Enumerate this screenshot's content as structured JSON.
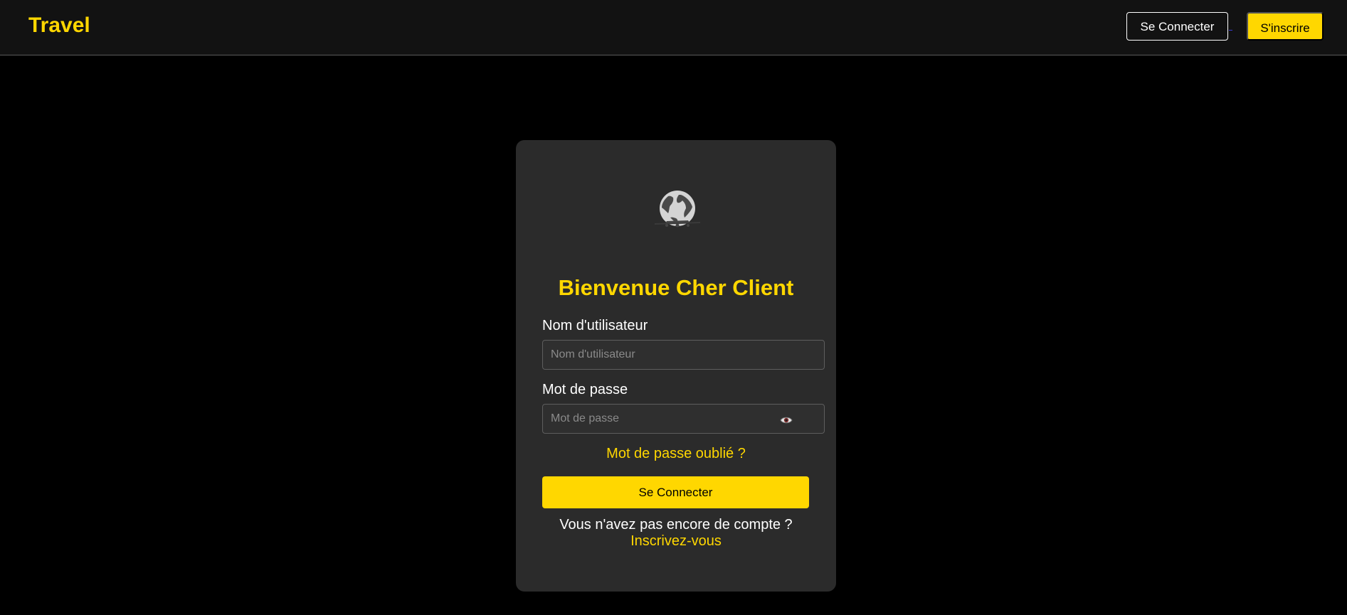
{
  "header": {
    "brand": "Travel",
    "login_label": "Se Connecter",
    "signup_label": "S'inscrire"
  },
  "login_card": {
    "logo_icon": "globe-airplane-icon",
    "title": "Bienvenue Cher Client",
    "username": {
      "label": "Nom d'utilisateur",
      "placeholder": "Nom d'utilisateur",
      "value": ""
    },
    "password": {
      "label": "Mot de passe",
      "placeholder": "Mot de passe",
      "value": "",
      "toggle_icon": "eye-icon"
    },
    "forgot_password": "Mot de passe oublié ?",
    "submit_label": "Se Connecter",
    "no_account_text": "Vous n'avez pas encore de compte ?",
    "signup_link": "Inscrivez-vous"
  },
  "colors": {
    "accent": "#FFD700",
    "background": "#000000",
    "header_bg": "#121212",
    "card_bg": "#2b2b2b"
  }
}
